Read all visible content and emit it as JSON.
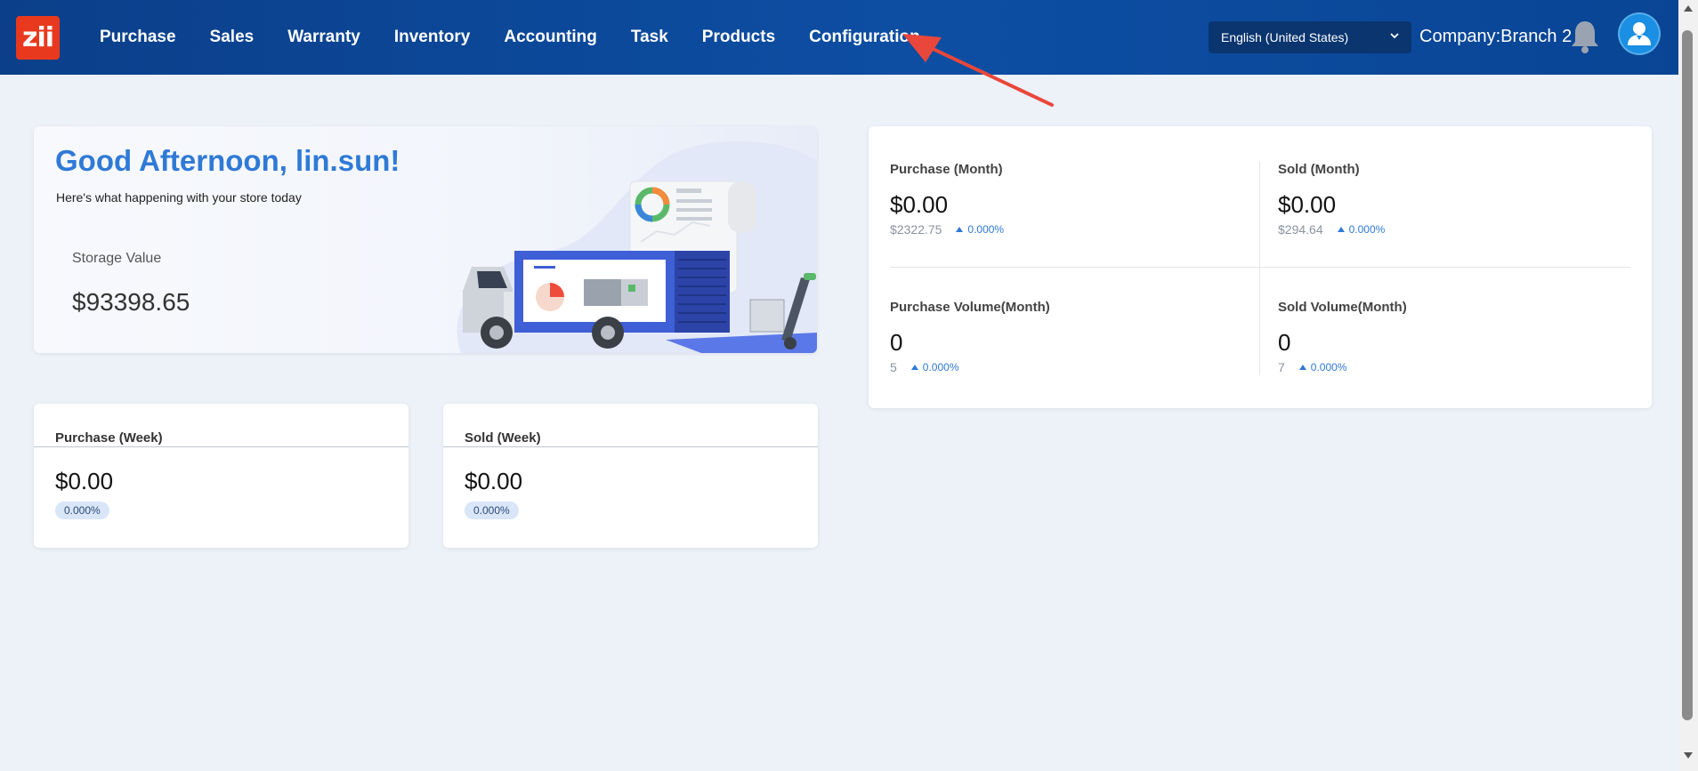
{
  "app": {
    "logo_text": "zii",
    "brand_color": "#e8391e",
    "header_color": "#0d4ea3",
    "accent": "#2f7ad6"
  },
  "nav": {
    "items": [
      "Purchase",
      "Sales",
      "Warranty",
      "Inventory",
      "Accounting",
      "Task",
      "Products",
      "Configuration"
    ]
  },
  "header": {
    "language": "English (United States)",
    "company": "Company:Branch 2",
    "icons": [
      "bell-icon",
      "user-avatar-icon",
      "chevron-down-icon"
    ]
  },
  "welcome": {
    "greeting": "Good Afternoon, lin.sun!",
    "subtext": "Here's what happening with your store today",
    "storage_label": "Storage Value",
    "storage_value": "$93398.65"
  },
  "week_cards": [
    {
      "title": "Purchase (Week)",
      "value": "$0.00",
      "change": "0.000%"
    },
    {
      "title": "Sold (Week)",
      "value": "$0.00",
      "change": "0.000%"
    }
  ],
  "month_stats": [
    {
      "label": "Purchase (Month)",
      "value": "$0.00",
      "previous": "$2322.75",
      "change": "0.000%"
    },
    {
      "label": "Sold (Month)",
      "value": "$0.00",
      "previous": "$294.64",
      "change": "0.000%"
    },
    {
      "label": "Purchase Volume(Month)",
      "value": "0",
      "previous": "5",
      "change": "0.000%"
    },
    {
      "label": "Sold Volume(Month)",
      "value": "0",
      "previous": "7",
      "change": "0.000%"
    }
  ]
}
